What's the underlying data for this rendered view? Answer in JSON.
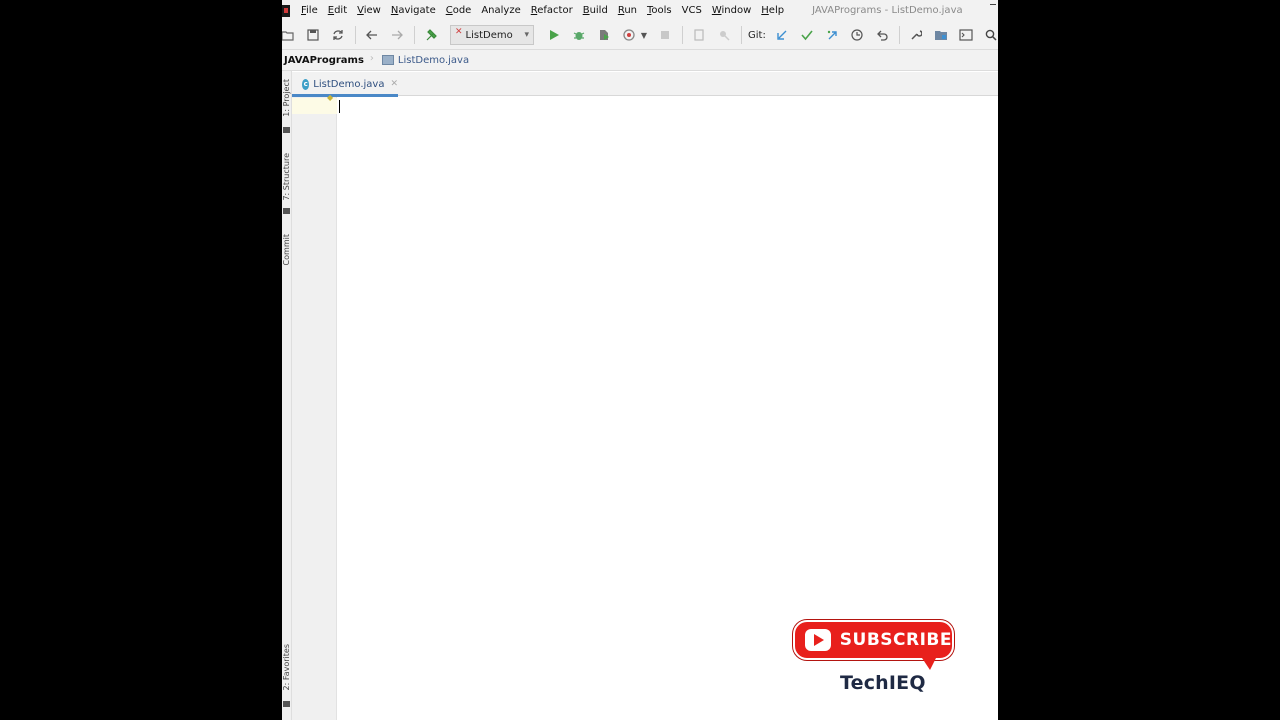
{
  "window": {
    "title": "JAVAPrograms - ListDemo.java"
  },
  "menu": {
    "items": [
      {
        "label": "File",
        "mnemonic": "F",
        "rest": "ile"
      },
      {
        "label": "Edit",
        "mnemonic": "E",
        "rest": "dit"
      },
      {
        "label": "View",
        "mnemonic": "V",
        "rest": "iew"
      },
      {
        "label": "Navigate",
        "mnemonic": "N",
        "rest": "avigate"
      },
      {
        "label": "Code",
        "mnemonic": "C",
        "rest": "ode"
      },
      {
        "label": "Analyze",
        "mnemonic": "",
        "rest": "Analyze"
      },
      {
        "label": "Refactor",
        "mnemonic": "R",
        "rest": "efactor"
      },
      {
        "label": "Build",
        "mnemonic": "B",
        "rest": "uild"
      },
      {
        "label": "Run",
        "mnemonic": "R",
        "rest": "un"
      },
      {
        "label": "Tools",
        "mnemonic": "T",
        "rest": "ools"
      },
      {
        "label": "VCS",
        "mnemonic": "",
        "rest": "VCS"
      },
      {
        "label": "Window",
        "mnemonic": "W",
        "rest": "indow"
      },
      {
        "label": "Help",
        "mnemonic": "H",
        "rest": "elp"
      }
    ]
  },
  "toolbar": {
    "run_config": "ListDemo",
    "git_label": "Git:",
    "colors": {
      "run": "#4aa34a",
      "debug": "#59a869",
      "git_update": "#3d8fd1",
      "git_commit": "#4aa34a"
    }
  },
  "navbar": {
    "project": "JAVAPrograms",
    "file": "ListDemo.java"
  },
  "tool_windows": {
    "project": "1: Project",
    "structure": "7: Structure",
    "commit": "Commit",
    "favorites": "2: Favorites"
  },
  "editor": {
    "tab_label": "ListDemo.java",
    "tab_icon": "c"
  },
  "overlay": {
    "subscribe_label": "SUBSCRIBE",
    "channel": "TechIEQ",
    "accent": "#e8201c"
  }
}
